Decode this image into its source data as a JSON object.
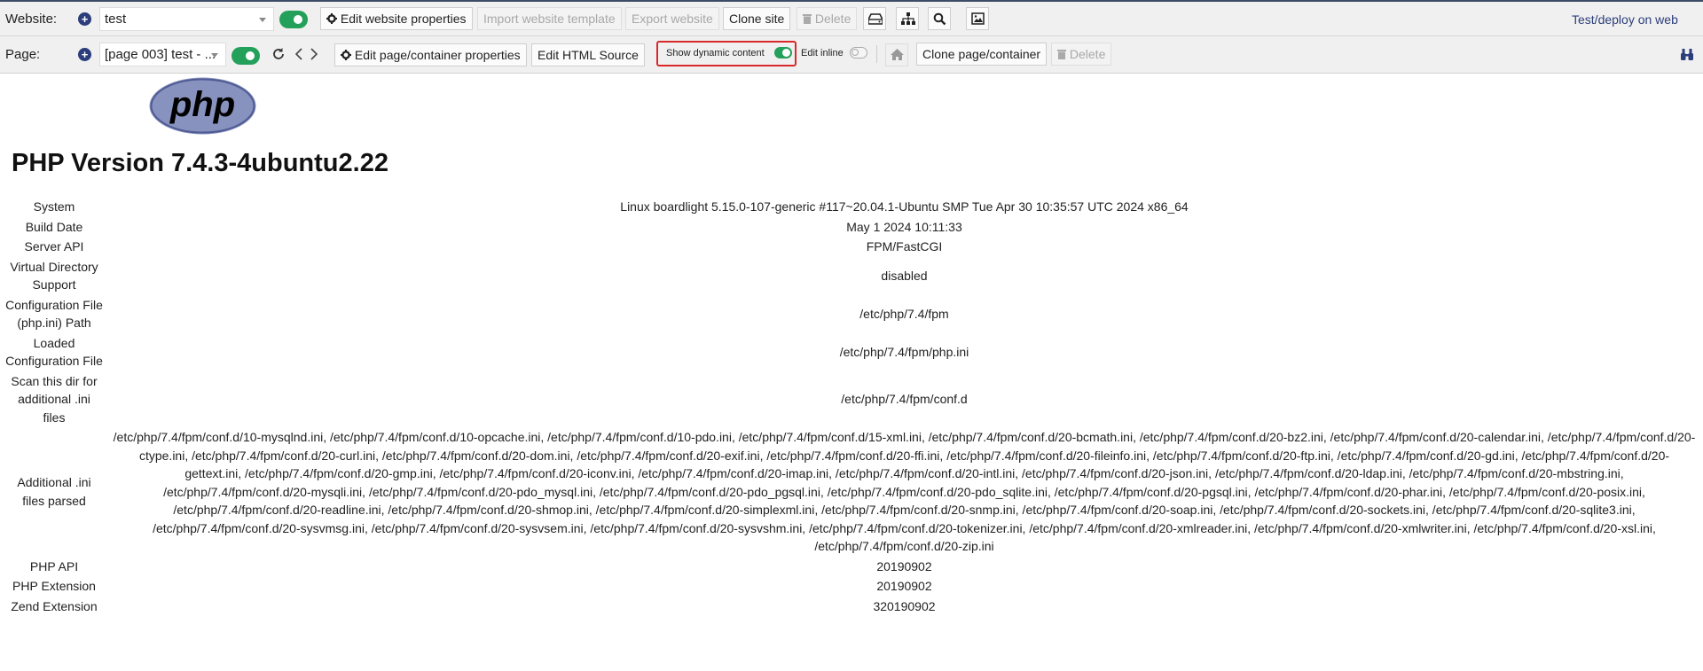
{
  "toolbar": {
    "website": {
      "label": "Website:",
      "selected": "test",
      "edit_props": "Edit website properties",
      "import_template": "Import website template",
      "export": "Export website",
      "clone_site": "Clone site",
      "delete": "Delete",
      "deploy_link": "Test/deploy on web"
    },
    "page": {
      "label": "Page:",
      "selected": "[page 003] test - ...",
      "edit_props": "Edit page/container properties",
      "edit_html": "Edit HTML Source",
      "dynamic": "Show dynamic content",
      "edit_inline": "Edit inline",
      "clone_page": "Clone page/container",
      "delete": "Delete"
    }
  },
  "colors": {
    "accent": "#2b3d7a",
    "toggle_on": "#23a05a",
    "highlight_border": "#d9292a",
    "php_logo": "#8892bf"
  },
  "phpinfo": {
    "logo_text": "php",
    "title": "PHP Version 7.4.3-4ubuntu2.22",
    "rows": [
      {
        "key": "System",
        "value": "Linux boardlight 5.15.0-107-generic #117~20.04.1-Ubuntu SMP Tue Apr 30 10:35:57 UTC 2024 x86_64"
      },
      {
        "key": "Build Date",
        "value": "May 1 2024 10:11:33"
      },
      {
        "key": "Server API",
        "value": "FPM/FastCGI"
      },
      {
        "key": "Virtual Directory Support",
        "value": "disabled"
      },
      {
        "key": "Configuration File (php.ini) Path",
        "value": "/etc/php/7.4/fpm"
      },
      {
        "key": "Loaded Configuration File",
        "value": "/etc/php/7.4/fpm/php.ini"
      },
      {
        "key": "Scan this dir for additional .ini files",
        "value": "/etc/php/7.4/fpm/conf.d"
      },
      {
        "key": "Additional .ini files parsed",
        "value": "/etc/php/7.4/fpm/conf.d/10-mysqlnd.ini, /etc/php/7.4/fpm/conf.d/10-opcache.ini, /etc/php/7.4/fpm/conf.d/10-pdo.ini, /etc/php/7.4/fpm/conf.d/15-xml.ini, /etc/php/7.4/fpm/conf.d/20-bcmath.ini, /etc/php/7.4/fpm/conf.d/20-bz2.ini, /etc/php/7.4/fpm/conf.d/20-calendar.ini, /etc/php/7.4/fpm/conf.d/20-ctype.ini, /etc/php/7.4/fpm/conf.d/20-curl.ini, /etc/php/7.4/fpm/conf.d/20-dom.ini, /etc/php/7.4/fpm/conf.d/20-exif.ini, /etc/php/7.4/fpm/conf.d/20-ffi.ini, /etc/php/7.4/fpm/conf.d/20-fileinfo.ini, /etc/php/7.4/fpm/conf.d/20-ftp.ini, /etc/php/7.4/fpm/conf.d/20-gd.ini, /etc/php/7.4/fpm/conf.d/20-gettext.ini, /etc/php/7.4/fpm/conf.d/20-gmp.ini, /etc/php/7.4/fpm/conf.d/20-iconv.ini, /etc/php/7.4/fpm/conf.d/20-imap.ini, /etc/php/7.4/fpm/conf.d/20-intl.ini, /etc/php/7.4/fpm/conf.d/20-json.ini, /etc/php/7.4/fpm/conf.d/20-ldap.ini, /etc/php/7.4/fpm/conf.d/20-mbstring.ini, /etc/php/7.4/fpm/conf.d/20-mysqli.ini, /etc/php/7.4/fpm/conf.d/20-pdo_mysql.ini, /etc/php/7.4/fpm/conf.d/20-pdo_pgsql.ini, /etc/php/7.4/fpm/conf.d/20-pdo_sqlite.ini, /etc/php/7.4/fpm/conf.d/20-pgsql.ini, /etc/php/7.4/fpm/conf.d/20-phar.ini, /etc/php/7.4/fpm/conf.d/20-posix.ini, /etc/php/7.4/fpm/conf.d/20-readline.ini, /etc/php/7.4/fpm/conf.d/20-shmop.ini, /etc/php/7.4/fpm/conf.d/20-simplexml.ini, /etc/php/7.4/fpm/conf.d/20-snmp.ini, /etc/php/7.4/fpm/conf.d/20-soap.ini, /etc/php/7.4/fpm/conf.d/20-sockets.ini, /etc/php/7.4/fpm/conf.d/20-sqlite3.ini, /etc/php/7.4/fpm/conf.d/20-sysvmsg.ini, /etc/php/7.4/fpm/conf.d/20-sysvsem.ini, /etc/php/7.4/fpm/conf.d/20-sysvshm.ini, /etc/php/7.4/fpm/conf.d/20-tokenizer.ini, /etc/php/7.4/fpm/conf.d/20-xmlreader.ini, /etc/php/7.4/fpm/conf.d/20-xmlwriter.ini, /etc/php/7.4/fpm/conf.d/20-xsl.ini, /etc/php/7.4/fpm/conf.d/20-zip.ini"
      },
      {
        "key": "PHP API",
        "value": "20190902"
      },
      {
        "key": "PHP Extension",
        "value": "20190902"
      },
      {
        "key": "Zend Extension",
        "value": "320190902"
      }
    ]
  }
}
